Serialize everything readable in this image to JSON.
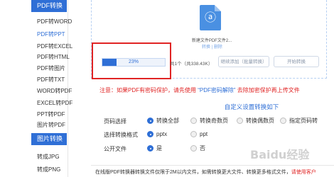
{
  "sidebar": {
    "section_pdf": "PDF转换",
    "items": [
      {
        "label": "PDF转WORD",
        "active": false
      },
      {
        "label": "PDF转PPT",
        "active": true
      },
      {
        "label": "PDF转EXCEL",
        "active": false
      },
      {
        "label": "PDF转HTML",
        "active": false
      },
      {
        "label": "PDF转图片",
        "active": false
      },
      {
        "label": "PDF转TXT",
        "active": false
      },
      {
        "label": "WORD转PDF",
        "active": false
      },
      {
        "label": "EXCEL转PDF",
        "active": false
      },
      {
        "label": "PPT转PDF",
        "active": false
      },
      {
        "label": "图片转PDF",
        "active": false
      }
    ],
    "section_image": "图片转换",
    "image_items": [
      {
        "label": "转成JPG"
      },
      {
        "label": "转成PNG"
      }
    ]
  },
  "file": {
    "name": "新建文件PDF文件2...",
    "actions": "转换  |  删除"
  },
  "progress": {
    "percent": 23,
    "label": "23%"
  },
  "file_count": "共1个（共338.43K）",
  "buttons": {
    "continue_add": "继续添加（批量转换）",
    "start": "开始转换"
  },
  "notice": {
    "prefix": "注意：如果PDF有密码保护，请先使用",
    "link": "“PDF密码解除”",
    "suffix": "去除加密保护再上传文件"
  },
  "settings": {
    "title": "自定义设置转换如下",
    "page_select": {
      "label": "页码选择",
      "options": [
        "转换全部",
        "转换奇数页",
        "转换偶数页",
        "指定页码转"
      ],
      "selected": 0
    },
    "format": {
      "label": "选择转换格式",
      "options": [
        "pptx",
        "ppt"
      ],
      "selected": 0
    },
    "public": {
      "label": "公开文件",
      "options": [
        "是",
        "否"
      ],
      "selected": 0
    }
  },
  "footer": {
    "text": "在线版PDF转换器转换文件仅限于2M以内文件，如需转换更大文件、转换更多格式文件，",
    "warn": "请使用客户"
  },
  "watermark": "Baidu经验",
  "colors": {
    "accent": "#2f6fd6",
    "alert": "#e02424"
  }
}
